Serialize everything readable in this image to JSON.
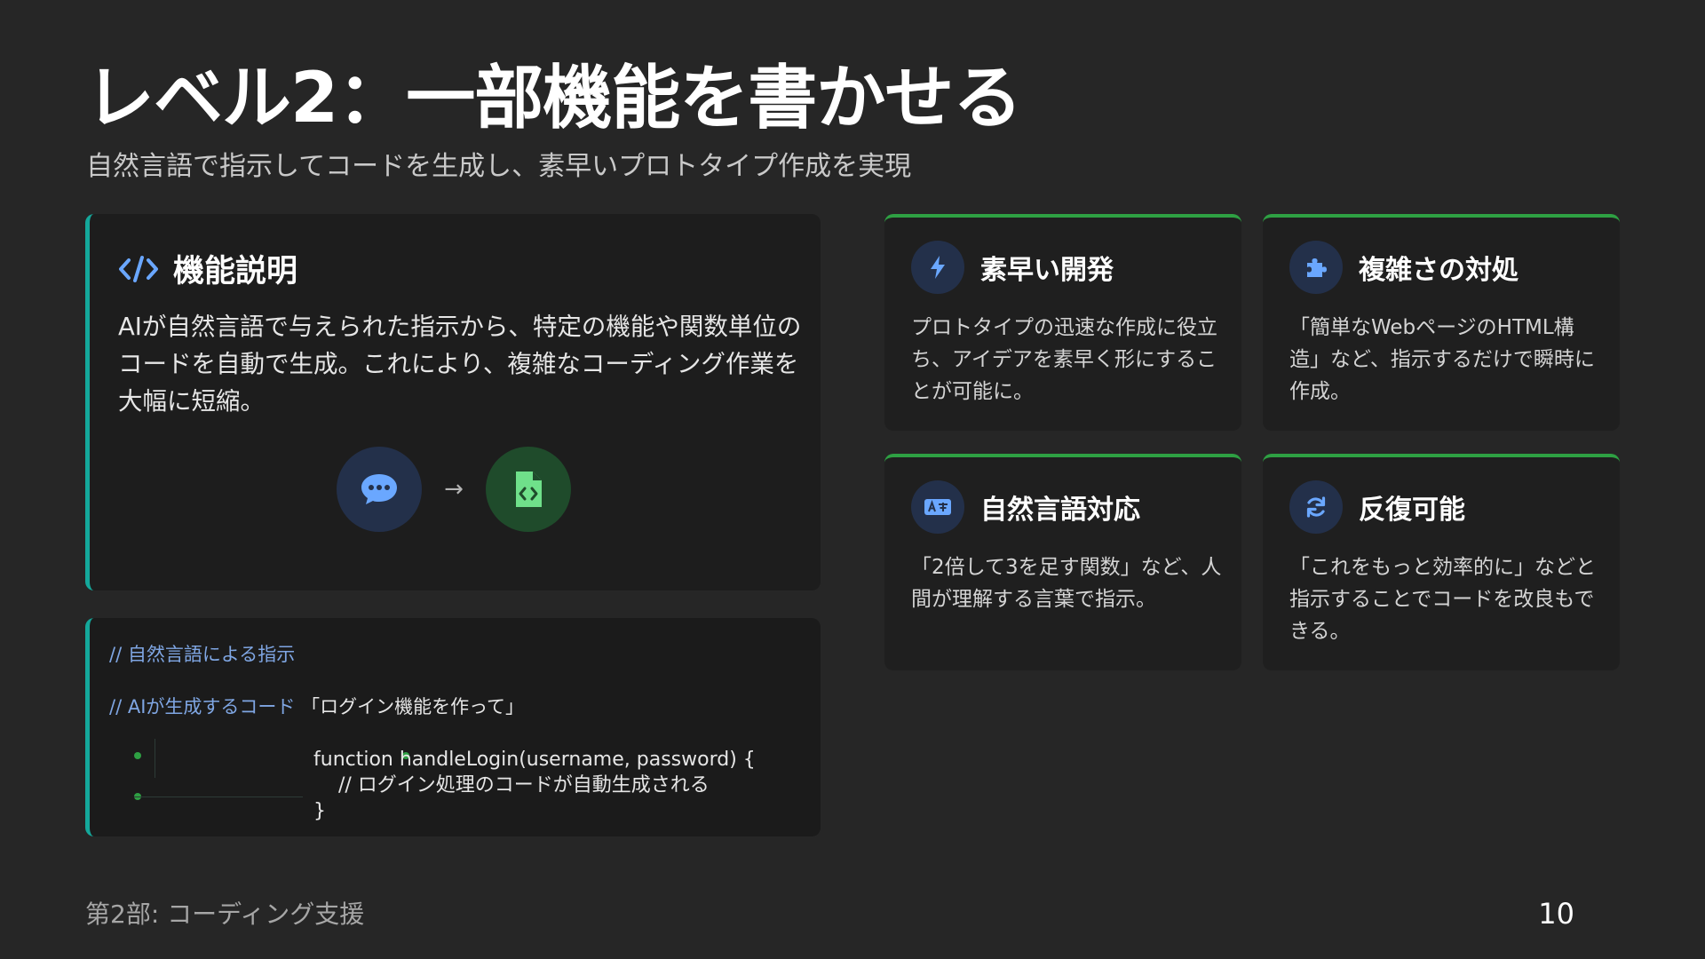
{
  "slide": {
    "title": "レベル2：一部機能を書かせる",
    "subtitle": "自然言語で指示してコードを生成し、素早いプロトタイプ作成を実現"
  },
  "description_card": {
    "icon": "code-icon",
    "title": "機能説明",
    "text": "AIが自然言語で与えられた指示から、特定の機能や関数単位のコードを自動で生成。これにより、複雑なコーディング作業を大幅に短縮。",
    "flow": {
      "from_icon": "chat-bubble-icon",
      "arrow": "→",
      "to_icon": "code-file-icon"
    }
  },
  "code_card": {
    "comment_instruction": "// 自然言語による指示",
    "comment_generated": "// AIが生成するコード",
    "instruction_quote": "「ログイン機能を作って」",
    "code_line1": "function handleLogin(username, password) {",
    "code_line2": "    // ログイン処理のコードが自動生成される",
    "code_line3": "}"
  },
  "features": [
    {
      "icon": "bolt-icon",
      "title": "素早い開発",
      "text": "プロトタイプの迅速な作成に役立ち、アイデアを素早く形にすることが可能に。"
    },
    {
      "icon": "puzzle-icon",
      "title": "複雑さの対処",
      "text": "「簡単なWebページのHTML構造」など、指示するだけで瞬時に作成。"
    },
    {
      "icon": "language-icon",
      "title": "自然言語対応",
      "text": "「2倍して3を足す関数」など、人間が理解する言葉で指示。"
    },
    {
      "icon": "refresh-icon",
      "title": "反復可能",
      "text": "「これをもっと効率的に」などと指示することでコードを改良もできる。"
    }
  ],
  "footer": {
    "section": "第2部: コーディング支援",
    "page_number": "10"
  },
  "colors": {
    "background": "#262626",
    "card": "#1f1f1f",
    "teal_accent": "#14a89b",
    "green_accent": "#2ea043",
    "icon_blue": "#6aa7ff",
    "icon_green": "#6fe08a"
  }
}
